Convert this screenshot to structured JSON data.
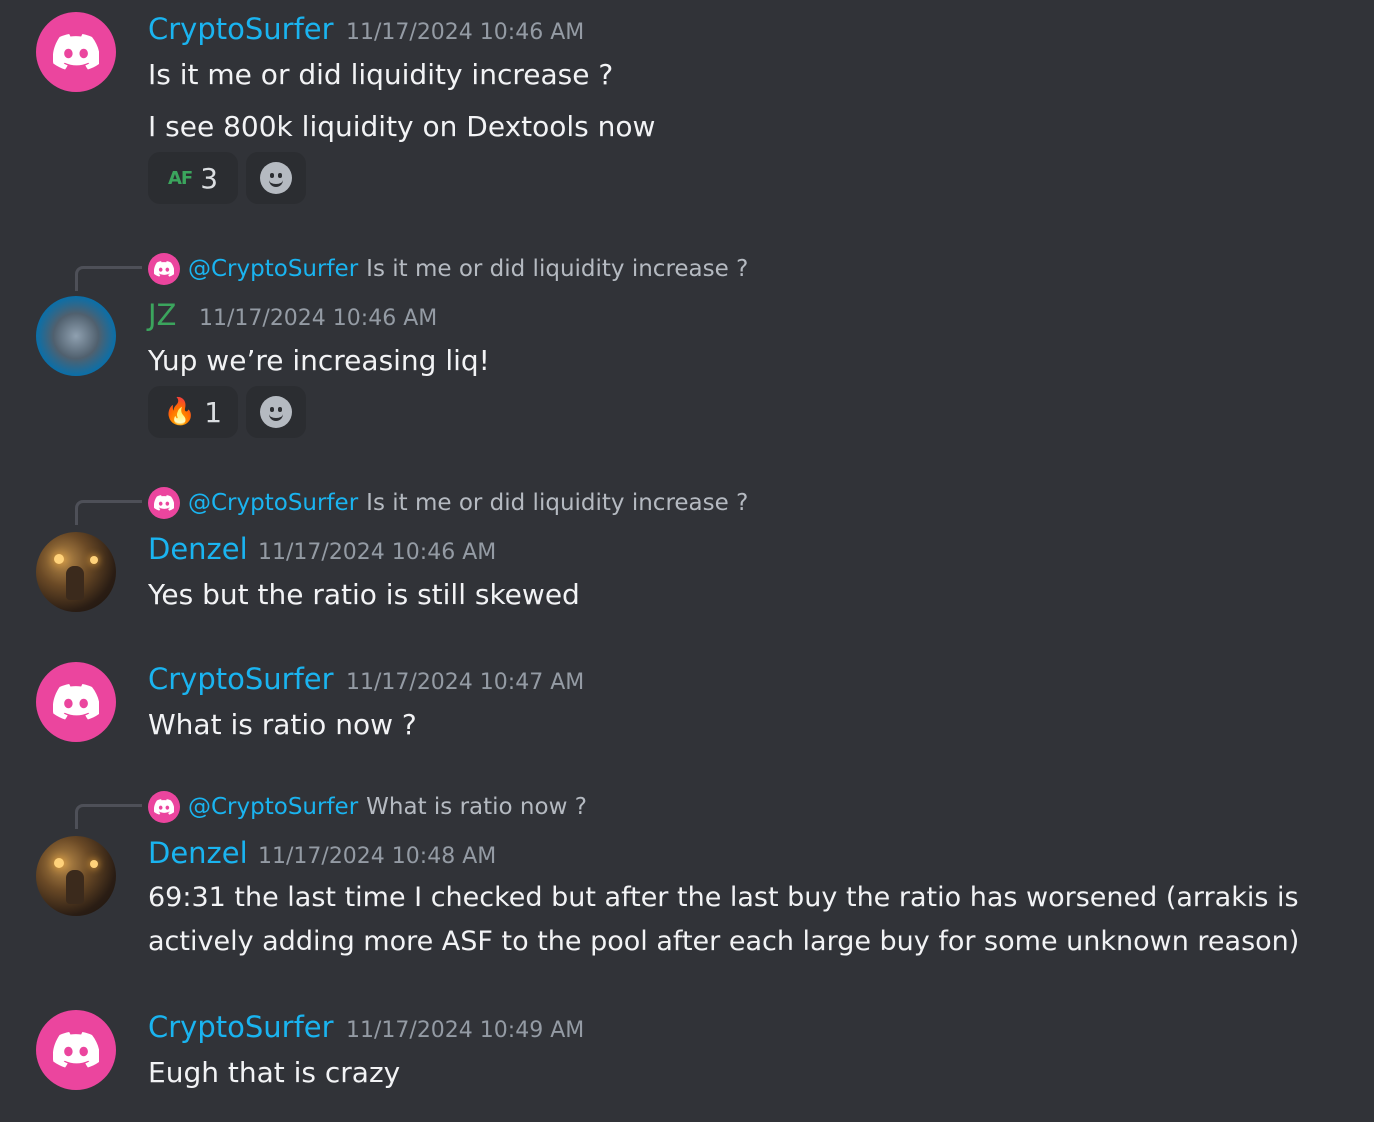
{
  "messages": [
    {
      "author": "CryptoSurfer",
      "timestamp": "11/17/2024 10:46 AM",
      "lines": [
        "Is it me or did liquidity increase ?",
        "I see 800k liquidity on Dextools now"
      ],
      "reactions": [
        {
          "emoji": "AF",
          "count": "3"
        }
      ]
    },
    {
      "reply_to": {
        "mention": "@CryptoSurfer",
        "text": "Is it me or did liquidity increase ?"
      },
      "author": "JZ",
      "timestamp": "11/17/2024 10:46 AM",
      "lines": [
        "Yup we’re increasing liq!"
      ],
      "reactions": [
        {
          "emoji": "🔥",
          "count": "1"
        }
      ]
    },
    {
      "reply_to": {
        "mention": "@CryptoSurfer",
        "text": "Is it me or did liquidity increase ?"
      },
      "author": "Denzel",
      "timestamp": "11/17/2024 10:46 AM",
      "lines": [
        "Yes but the ratio is still skewed"
      ]
    },
    {
      "author": "CryptoSurfer",
      "timestamp": "11/17/2024 10:47 AM",
      "lines": [
        "What is ratio now ?"
      ]
    },
    {
      "reply_to": {
        "mention": "@CryptoSurfer",
        "text": "What is ratio now ?"
      },
      "author": "Denzel",
      "timestamp": "11/17/2024 10:48 AM",
      "lines": [
        "69:31 the last time I checked but after the last buy the ratio has worsened (arrakis is",
        "actively adding more ASF to the pool after each large buy for some unknown reason)"
      ]
    },
    {
      "author": "CryptoSurfer",
      "timestamp": "11/17/2024 10:49 AM",
      "lines": [
        "Eugh that is crazy"
      ]
    }
  ],
  "colors": {
    "background": "#313338",
    "username_blue": "#1ab4f0",
    "username_green": "#3ba55d",
    "discord_pink": "#eb459e"
  }
}
